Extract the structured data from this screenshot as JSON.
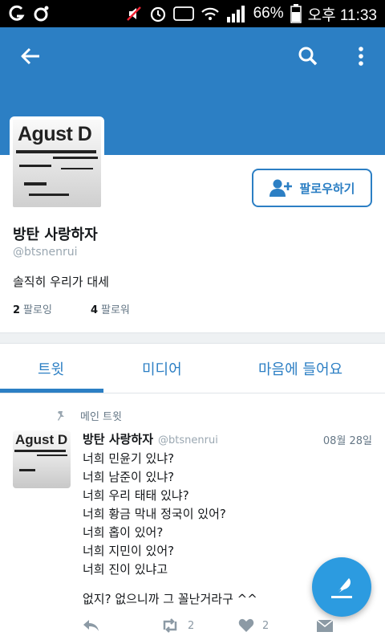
{
  "status_bar": {
    "battery": "66%",
    "time": "오후 11:33",
    "hd_label": "HD"
  },
  "profile": {
    "avatar_text": "Agust D",
    "display_name": "방탄 사랑하자",
    "handle": "@btsnenrui",
    "bio": "솔직히 우리가 대세",
    "following_count": "2",
    "following_label": "팔로잉",
    "followers_count": "4",
    "followers_label": "팔로워",
    "follow_button": "팔로우하기"
  },
  "tabs": [
    {
      "label": "트윗",
      "active": true
    },
    {
      "label": "미디어",
      "active": false
    },
    {
      "label": "마음에 들어요",
      "active": false
    }
  ],
  "pinned_label": "메인 트윗",
  "tweet": {
    "avatar_text": "Agust D",
    "name": "방탄 사랑하자",
    "handle": "@btsnenrui",
    "date": "08월 28일",
    "lines": [
      "너희 민윤기 있냐?",
      "너희 남준이 있냐?",
      "너희 우리 태태 있냐?",
      "너희 황금 막내 정국이 있어?",
      "너희 홉이 있어?",
      "너희 지민이 있어?",
      "너희 진이 있냐고",
      "없지? 없으니까 그 꼴난거라구 ^^"
    ],
    "retweets": "2",
    "likes": "2"
  },
  "colors": {
    "brand": "#2c7fc4",
    "fab": "#2c9be0"
  }
}
